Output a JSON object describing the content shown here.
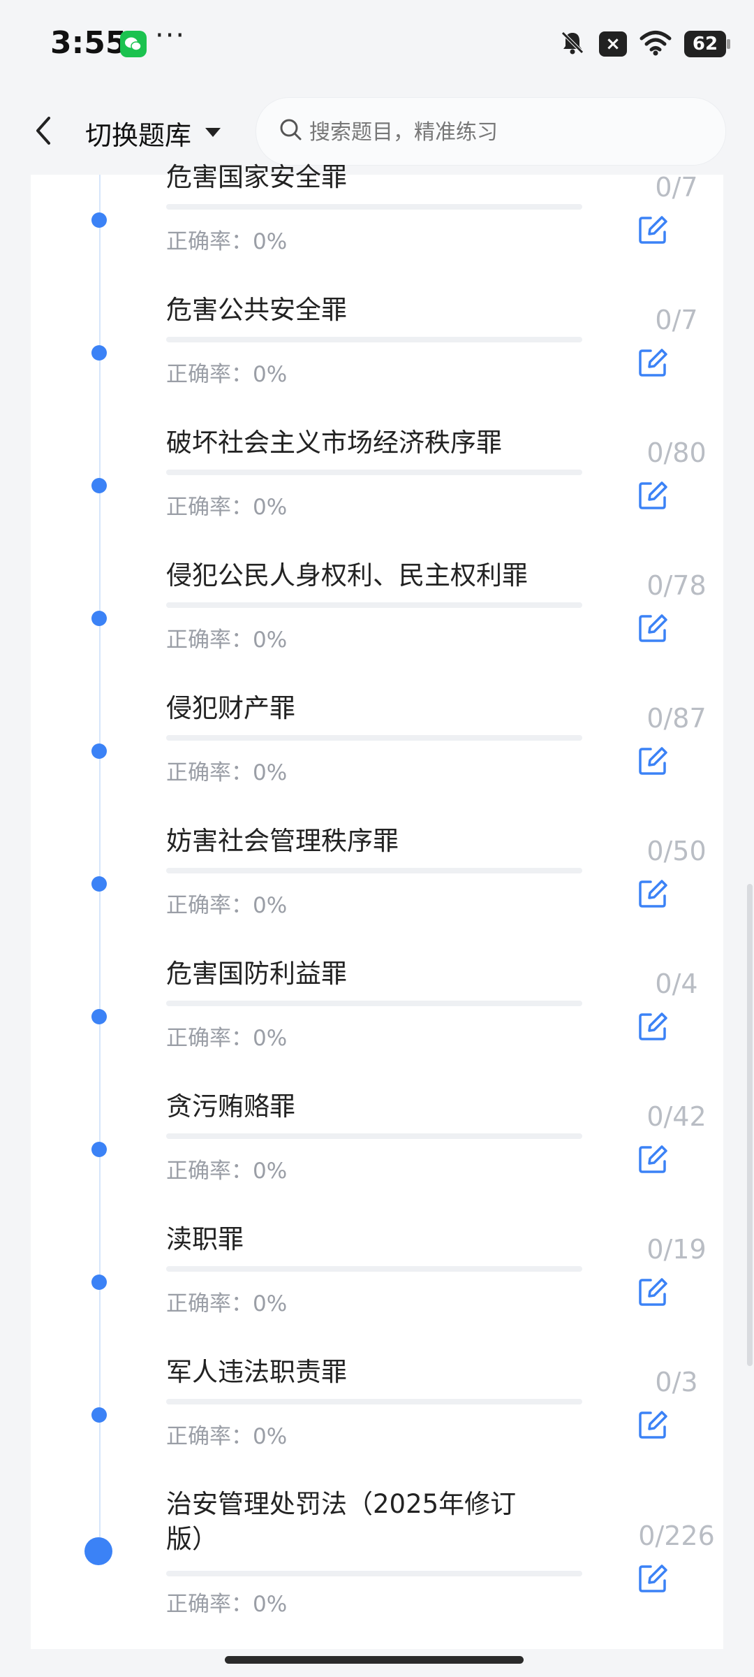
{
  "status_bar": {
    "time": "3:55",
    "dots": "···",
    "battery": "62",
    "notif_badge": "×"
  },
  "header": {
    "title": "切换题库",
    "search_placeholder": "搜索题目，精准练习"
  },
  "colors": {
    "accent": "#3b82f6",
    "timeline": "#d6e6fb",
    "muted_text": "#9a9ea6",
    "count_text": "#b9bdc4"
  },
  "items": [
    {
      "name": "危害国家安全罪",
      "accuracy": "正确率：0%",
      "count": "0/7",
      "progress": 0
    },
    {
      "name": "危害公共安全罪",
      "accuracy": "正确率：0%",
      "count": "0/7",
      "progress": 0
    },
    {
      "name": "破坏社会主义市场经济秩序罪",
      "accuracy": "正确率：0%",
      "count": "0/80",
      "progress": 0
    },
    {
      "name": "侵犯公民人身权利、民主权利罪",
      "accuracy": "正确率：0%",
      "count": "0/78",
      "progress": 0
    },
    {
      "name": "侵犯财产罪",
      "accuracy": "正确率：0%",
      "count": "0/87",
      "progress": 0
    },
    {
      "name": "妨害社会管理秩序罪",
      "accuracy": "正确率：0%",
      "count": "0/50",
      "progress": 0
    },
    {
      "name": "危害国防利益罪",
      "accuracy": "正确率：0%",
      "count": "0/4",
      "progress": 0
    },
    {
      "name": "贪污贿赂罪",
      "accuracy": "正确率：0%",
      "count": "0/42",
      "progress": 0
    },
    {
      "name": "渎职罪",
      "accuracy": "正确率：0%",
      "count": "0/19",
      "progress": 0
    },
    {
      "name": "军人违法职责罪",
      "accuracy": "正确率：0%",
      "count": "0/3",
      "progress": 0
    },
    {
      "name": "治安管理处罚法（2025年修订版）",
      "accuracy": "正确率：0%",
      "count": "0/226",
      "progress": 0
    }
  ]
}
